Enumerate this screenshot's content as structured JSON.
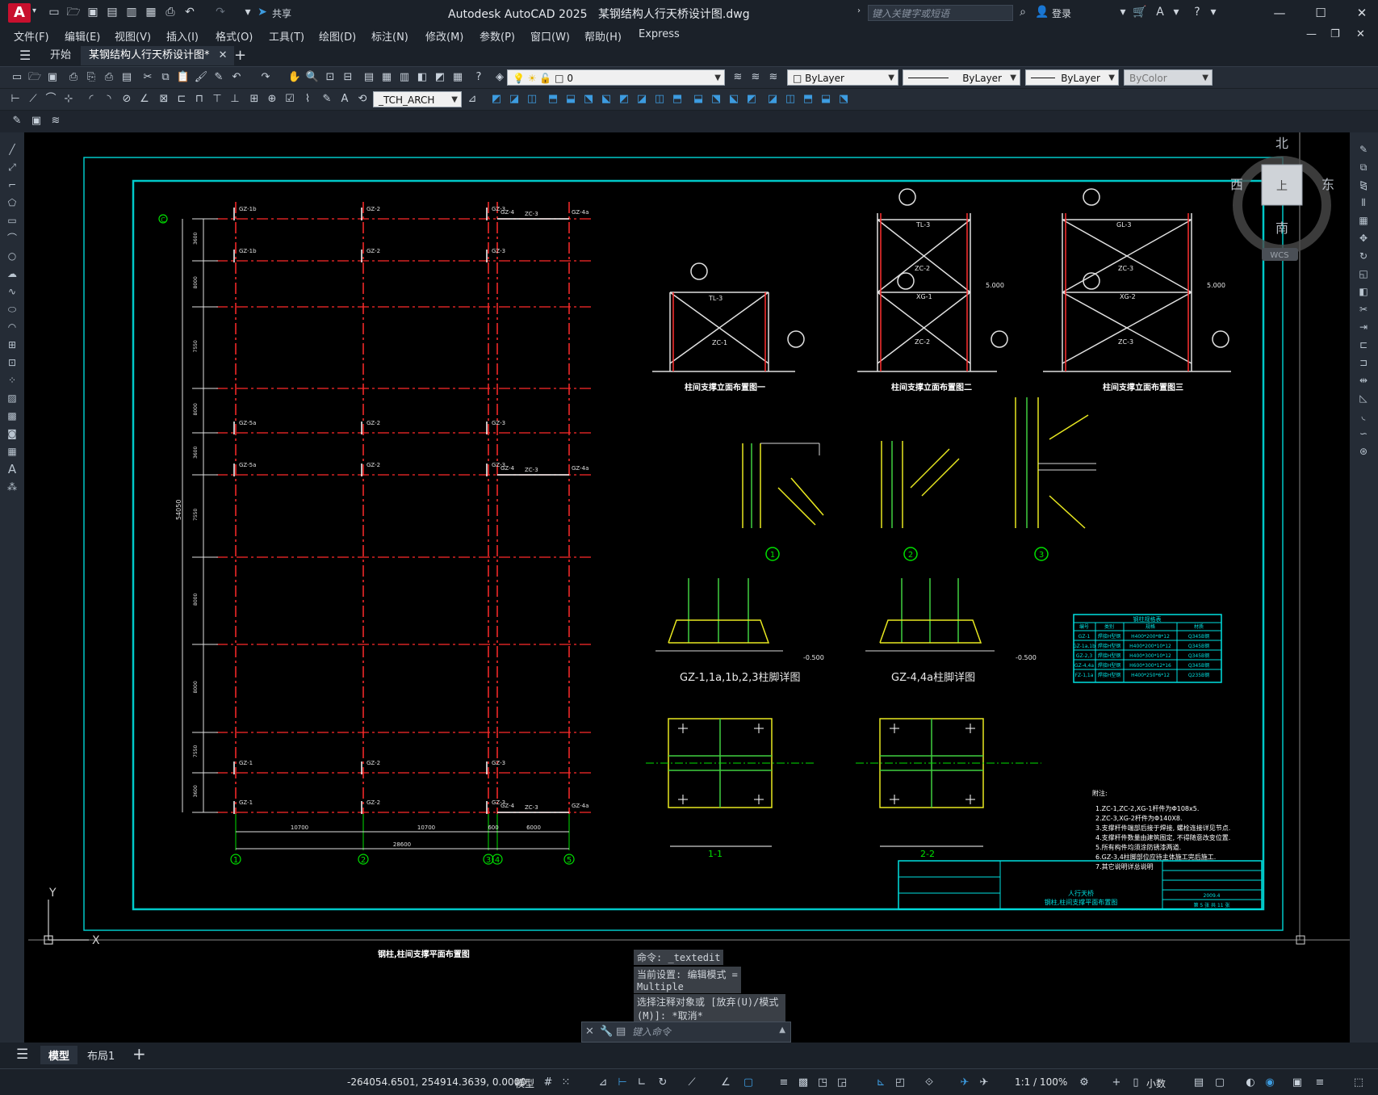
{
  "titlebar": {
    "app_title": "Autodesk AutoCAD 2025",
    "file_name": "某钢结构人行天桥设计图.dwg",
    "share_label": "共享",
    "search_placeholder": "键入关键字或短语",
    "login_label": "登录"
  },
  "menu": [
    "文件(F)",
    "编辑(E)",
    "视图(V)",
    "插入(I)",
    "格式(O)",
    "工具(T)",
    "绘图(D)",
    "标注(N)",
    "修改(M)",
    "参数(P)",
    "窗口(W)",
    "帮助(H)",
    "Express"
  ],
  "tabs": {
    "start": "开始",
    "drawing": "某钢结构人行天桥设计图*"
  },
  "toolbar": {
    "layer_value": "0",
    "color": "ByLayer",
    "linetype": "ByLayer",
    "lineweight": "ByLayer",
    "plotstyle": "ByColor",
    "textstyle": "_TCH_ARCH"
  },
  "viewcube": {
    "north": "北",
    "south": "南",
    "east": "东",
    "west": "西",
    "top": "上",
    "wcs": "WCS"
  },
  "drawing": {
    "plan_title": "钢柱,柱间支撑平面布置图",
    "axis_labels": [
      "1",
      "2",
      "3",
      "4",
      "5"
    ],
    "row_label": "C",
    "total_dim": "28600",
    "span_dims": [
      "10700",
      "10700",
      "600",
      "6000"
    ],
    "vertical_total": "54050",
    "vertical_dims": [
      "3600",
      "8000",
      "7550",
      "8000",
      "3600",
      "7550",
      "8000",
      "8000",
      "7550",
      "3600"
    ],
    "column_labels": [
      "GZ-1b",
      "GZ-2",
      "GZ-3",
      "GZ-4",
      "GZ-4a",
      "GZ-5a",
      "GZ-1",
      "ZC-3",
      "ZC-1"
    ],
    "elevation_titles": [
      "柱间支撑立面布置图一",
      "柱间支撑立面布置图二",
      "柱间支撑立面布置图三"
    ],
    "elev_labels": {
      "e1_top": "TL-3",
      "e1_brace": "ZC-1",
      "e2_top": "TL-3",
      "e2_mid": "XG-1",
      "e2_brace_top": "ZC-2",
      "e2_brace_bot": "ZC-2",
      "e3_top": "GL-3",
      "e3_mid": "XG-2",
      "e3_brace_top": "ZC-3",
      "e3_brace_bot": "ZC-3",
      "elevation": "5.000"
    },
    "detail_numbers": [
      "1",
      "2",
      "3"
    ],
    "base_titles": [
      "GZ-1,1a,1b,2,3柱脚详图",
      "GZ-4,4a柱脚详图"
    ],
    "section_titles": [
      "1-1",
      "2-2"
    ],
    "level": "-0.500",
    "table_title": "钢柱规格表",
    "table_headers": [
      "编号",
      "类别",
      "规格",
      "材质"
    ],
    "table_rows": [
      [
        "GZ-1",
        "焊接H型钢",
        "H400*200*8*12",
        "Q345B钢"
      ],
      [
        "GZ-1a,1b",
        "焊接H型钢",
        "H400*200*10*12",
        "Q345B钢"
      ],
      [
        "GZ-2,3",
        "焊接H型钢",
        "H400*300*10*12",
        "Q345B钢"
      ],
      [
        "GZ-4,4a",
        "焊接H型钢",
        "H600*300*12*16",
        "Q345B钢"
      ],
      [
        "FZ-1,1a",
        "焊接H型钢",
        "H400*250*6*12",
        "Q235B钢"
      ]
    ],
    "notes_title": "附注:",
    "notes": [
      "1.ZC-1,ZC-2,XG-1杆件为Φ108x5.",
      "2.ZC-3,XG-2杆件为Φ140X8.",
      "3.支撑杆件端部后接于焊接, 螺栓连接详见节点.",
      "4.支撑杆件数量由建筑图定, 不得随意改变位置.",
      "5.所有构件均须涂防锈漆两道.",
      "6.GZ-3,4柱脚部位应待主体施工完后施工.",
      "7.其它说明详总说明"
    ],
    "titleblock": {
      "project": "人行天桥",
      "sheet": "钢柱,柱间支撑平面布置图",
      "date": "2009.4",
      "sheet_no": "第 5 张 共 11 张"
    }
  },
  "command": {
    "history": [
      "命令: _textedit",
      "当前设置: 编辑模式 = Multiple",
      "选择注释对象或 [放弃(U)/模式(M)]: *取消*"
    ],
    "placeholder": "键入命令"
  },
  "layout_tabs": {
    "model": "模型",
    "layout1": "布局1"
  },
  "status": {
    "coordinates": "-264054.6501, 254914.3639, 0.0000",
    "model": "模型",
    "scale": "1:1 / 100%",
    "units": "小数"
  }
}
